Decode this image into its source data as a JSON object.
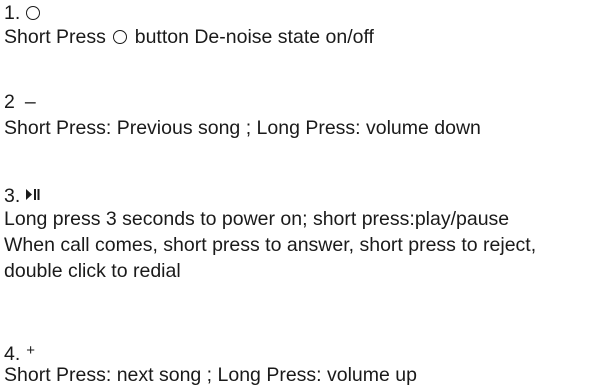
{
  "items": [
    {
      "number": "1.",
      "icon": "circle-icon",
      "line1_pre": "Short Press",
      "line1_post": "button De-noise state on/off"
    },
    {
      "number": "2",
      "symbol": "–",
      "line1": "Short Press: Previous song ; Long Press: volume down"
    },
    {
      "number": "3.",
      "icon": "play-pause-icon",
      "line1": "Long press  3 seconds to power on; short press:play/pause",
      "line2": "When call comes, short press to answer, short press to reject,",
      "line3": "double click to redial"
    },
    {
      "number": "4.",
      "symbol": "+",
      "line1": "Short Press: next  song ; Long Press: volume up"
    }
  ]
}
